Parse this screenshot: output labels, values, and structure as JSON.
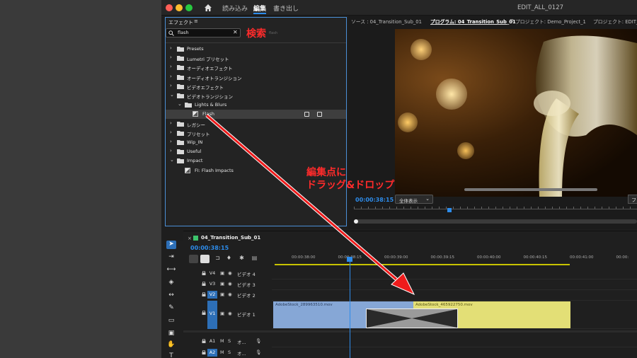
{
  "titlebar": {
    "tabs": [
      "読み込み",
      "編集",
      "書き出し"
    ],
    "active_tab": "編集",
    "title": "EDIT_ALL_0127"
  },
  "effects_panel": {
    "title": "エフェクト",
    "menu": "≡",
    "search_value": "flash",
    "tree": [
      {
        "label": "Presets",
        "indent": 0,
        "chevron": "›",
        "type": "folder"
      },
      {
        "label": "Lumetri プリセット",
        "indent": 0,
        "chevron": "›",
        "type": "folder"
      },
      {
        "label": "オーディオエフェクト",
        "indent": 0,
        "chevron": "›",
        "type": "folder"
      },
      {
        "label": "オーディオトランジション",
        "indent": 0,
        "chevron": "›",
        "type": "folder"
      },
      {
        "label": "ビデオエフェクト",
        "indent": 0,
        "chevron": "›",
        "type": "folder"
      },
      {
        "label": "ビデオトランジション",
        "indent": 0,
        "chevron": "⌄",
        "type": "folder"
      },
      {
        "label": "Lights & Blurs",
        "indent": 1,
        "chevron": "⌄",
        "type": "folder"
      },
      {
        "label": "Flash",
        "indent": 2,
        "chevron": "",
        "type": "file",
        "selected": true
      },
      {
        "label": "レガシー",
        "indent": 0,
        "chevron": "›",
        "type": "folder"
      },
      {
        "label": "プリセット",
        "indent": 0,
        "chevron": "›",
        "type": "folder"
      },
      {
        "label": "Wip_IN",
        "indent": 0,
        "chevron": "›",
        "type": "folder"
      },
      {
        "label": "Useful",
        "indent": 0,
        "chevron": "›",
        "type": "folder"
      },
      {
        "label": "Impact",
        "indent": 0,
        "chevron": "⌄",
        "type": "folder"
      },
      {
        "label": "FI: Flash Impacts",
        "indent": 1,
        "chevron": "",
        "type": "file"
      }
    ]
  },
  "monitor": {
    "tabs": [
      "ソース : 04_Transition_Sub_01",
      "プログラム: 04_Transition_Sub_01",
      "≡",
      "プロジェクト: Demo_Project_1",
      "プロジェクト: EDIT_A"
    ],
    "active_tab_index": 1,
    "timecode": "00:00:38:15",
    "fit_label": "全体表示",
    "right_button": "フ"
  },
  "timeline": {
    "sequence_name": "04_Transition_Sub_01",
    "menu": "≡",
    "timecode": "00:00:38:15",
    "ruler_labels": [
      "00:00:38:00",
      "00:00:38:15",
      "00:00:39:00",
      "00:00:39:15",
      "00:00:40:00",
      "00:00:40:15",
      "00:00:41:00",
      "00:00:"
    ],
    "video_tracks": [
      {
        "id": "V4",
        "name": "ビデオ 4"
      },
      {
        "id": "V3",
        "name": "ビデオ 3"
      },
      {
        "id": "V2",
        "name": "ビデオ 2"
      },
      {
        "id": "V1",
        "name": "ビデオ 1"
      }
    ],
    "audio_tracks": [
      {
        "id": "A1",
        "m": "M",
        "s": "S",
        "name": "オ..."
      },
      {
        "id": "A2",
        "m": "M",
        "s": "S",
        "name": "オ..."
      }
    ],
    "clips": [
      {
        "name": "AdobeStock_289963510.mov"
      },
      {
        "name": "AdobeStock_465922750.mov"
      }
    ]
  },
  "annotations": {
    "search": "検索",
    "search_sub": "flash",
    "drop_line1": "編集点に",
    "drop_line2": "ドラッグ&ドロップ"
  },
  "colors": {
    "accent": "#2d8ceb",
    "annotation": "#ff2b2b",
    "clip_blue": "#86a7d6",
    "clip_yellow": "#e3df76"
  }
}
